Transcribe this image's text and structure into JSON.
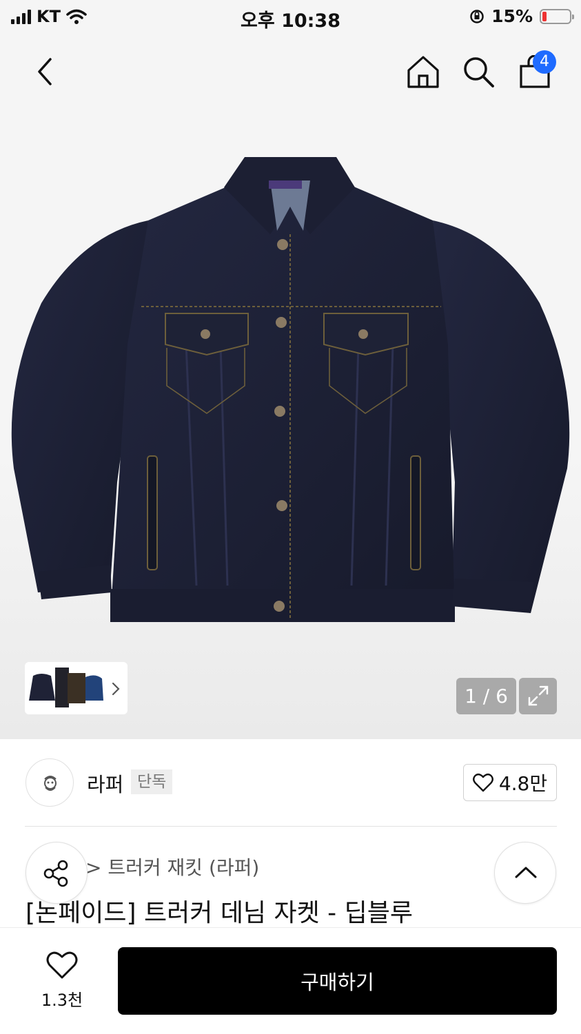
{
  "status_bar": {
    "carrier": "KT",
    "time": "오후 10:38",
    "battery_percent": "15%",
    "battery_level": 0.15
  },
  "header": {
    "cart_count": "4"
  },
  "gallery": {
    "page_indicator": "1 / 6"
  },
  "brand": {
    "name": "라퍼",
    "badge": "단독",
    "like_count": "4.8만"
  },
  "product": {
    "breadcrumb": "> 트러커 재킷 (라퍼)",
    "title": "[논페이드] 트러커 데님 자켓 - 딥블루"
  },
  "bottom_bar": {
    "wish_count": "1.3천",
    "buy_label": "구매하기"
  },
  "colors": {
    "accent_badge": "#1f6bff",
    "buy_button": "#000000",
    "denim": "#1f2236"
  }
}
